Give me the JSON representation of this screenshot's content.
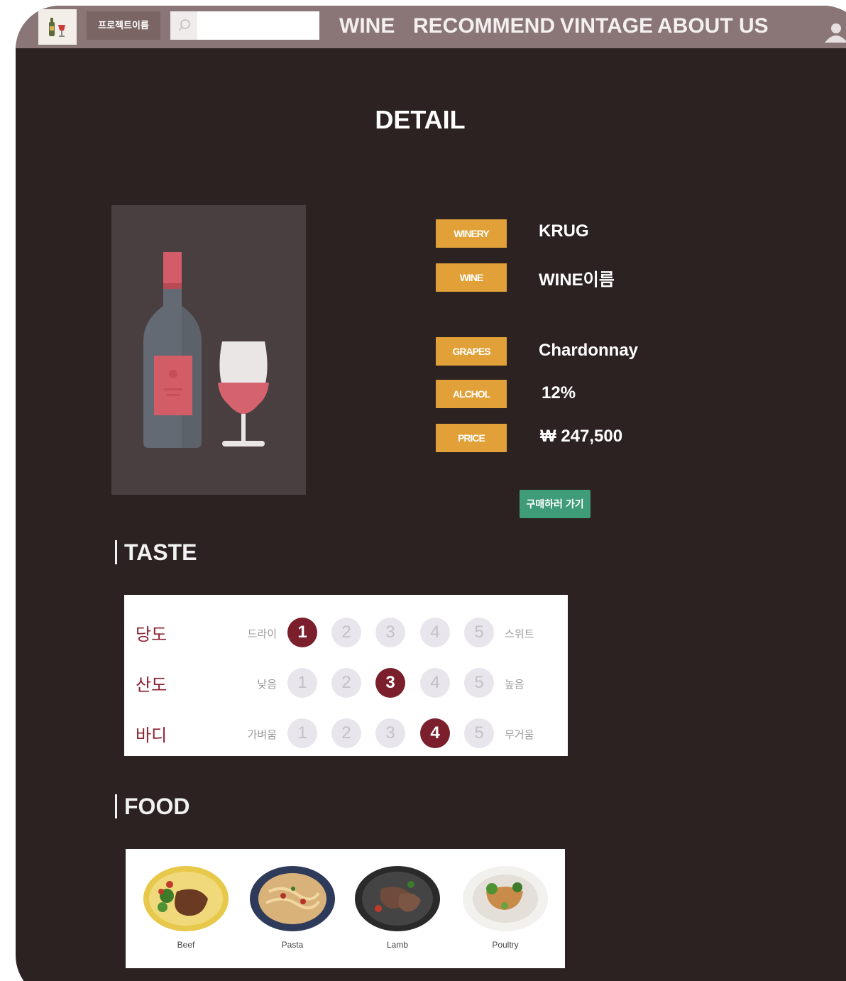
{
  "header": {
    "project_name": "프로젝트이름",
    "search_placeholder": "",
    "nav": [
      "WINE",
      "RECOMMEND",
      "VINTAGE",
      "ABOUT US"
    ]
  },
  "page_title": "DETAIL",
  "info": [
    {
      "label": "WINERY",
      "value": "KRUG"
    },
    {
      "label": "WINE",
      "value": "WINE이름"
    },
    {
      "label": "GRAPES",
      "value": "Chardonnay"
    },
    {
      "label": "ALCHOL",
      "value": "12%"
    },
    {
      "label": "PRICE",
      "value": "₩ 247,500"
    }
  ],
  "buy_button": "구매하러 가기",
  "taste": {
    "heading": "TASTE",
    "rows": [
      {
        "label": "당도",
        "low": "드라이",
        "high": "스위트",
        "selected": 1
      },
      {
        "label": "산도",
        "low": "낮음",
        "high": "높음",
        "selected": 3
      },
      {
        "label": "바디",
        "low": "가벼움",
        "high": "무거움",
        "selected": 4
      }
    ],
    "scale": [
      "1",
      "2",
      "3",
      "4",
      "5"
    ]
  },
  "food": {
    "heading": "FOOD",
    "items": [
      "Beef",
      "Pasta",
      "Lamb",
      "Poultry"
    ]
  },
  "colors": {
    "background": "#2c2222",
    "navbar": "#8a7676",
    "badge": "#e1a138",
    "buy": "#3f9c79",
    "accent": "#7c1f2d"
  }
}
